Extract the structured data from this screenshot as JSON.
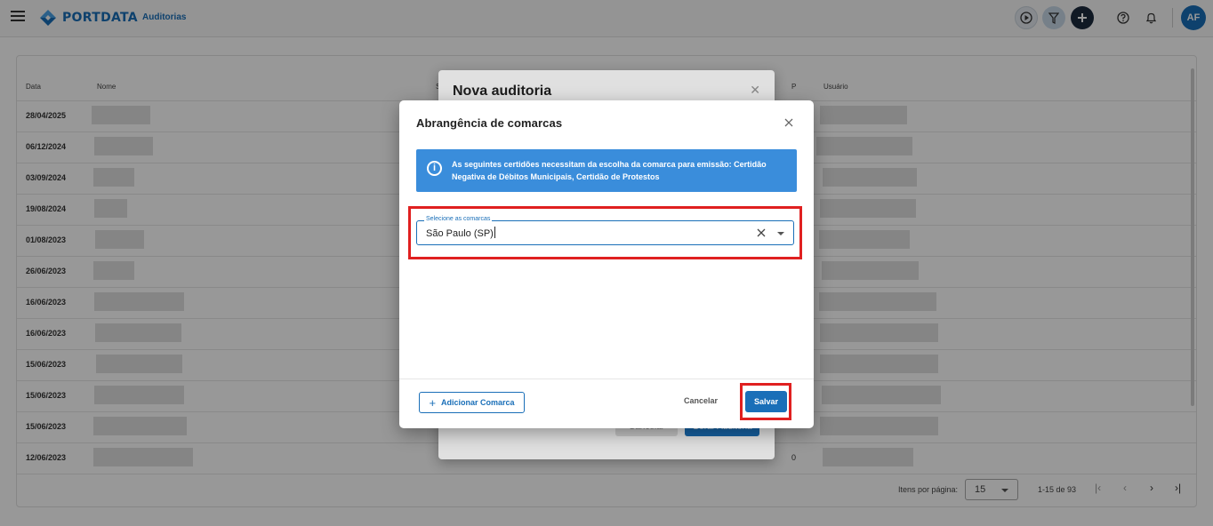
{
  "app": {
    "logo_text": "PORTDATA",
    "breadcrumb": "Auditorias",
    "avatar_initials": "AF",
    "brand_color": "#1a6fb8"
  },
  "toolbar_icons": [
    "play-icon",
    "filter-icon",
    "add-icon",
    "help-icon",
    "bell-icon"
  ],
  "table": {
    "columns": {
      "date": "Data",
      "name": "Nome",
      "s": "S",
      "p": "P",
      "user": "Usuário"
    },
    "rows": [
      {
        "date": "28/04/2025"
      },
      {
        "date": "06/12/2024"
      },
      {
        "date": "03/09/2024"
      },
      {
        "date": "19/08/2024"
      },
      {
        "date": "01/08/2023"
      },
      {
        "date": "26/06/2023"
      },
      {
        "date": "16/06/2023"
      },
      {
        "date": "16/06/2023"
      },
      {
        "date": "15/06/2023"
      },
      {
        "date": "15/06/2023"
      },
      {
        "date": "15/06/2023"
      },
      {
        "date": "12/06/2023",
        "p": "0"
      }
    ],
    "paginator": {
      "items_label": "Itens por página:",
      "page_size": "15",
      "range": "1-15 de 93"
    }
  },
  "back_dialog": {
    "title": "Nova auditoria",
    "cancel": "Cancelar",
    "next": "Gerar Auditoria"
  },
  "dialog": {
    "title": "Abrangência de comarcas",
    "info_prefix": "As seguintes certidões necessitam da escolha da comarca para emissão: ",
    "info_bold": "Certidão Negativa de Débitos Municipais, Certidão de Protestos",
    "field_label": "Selecione as comarcas",
    "field_value": "São Paulo  (SP)",
    "add_button": "Adicionar Comarca",
    "cancel_button": "Cancelar",
    "save_button": "Salvar",
    "highlight_color": "#e02020",
    "info_color": "#3a8ddb"
  }
}
